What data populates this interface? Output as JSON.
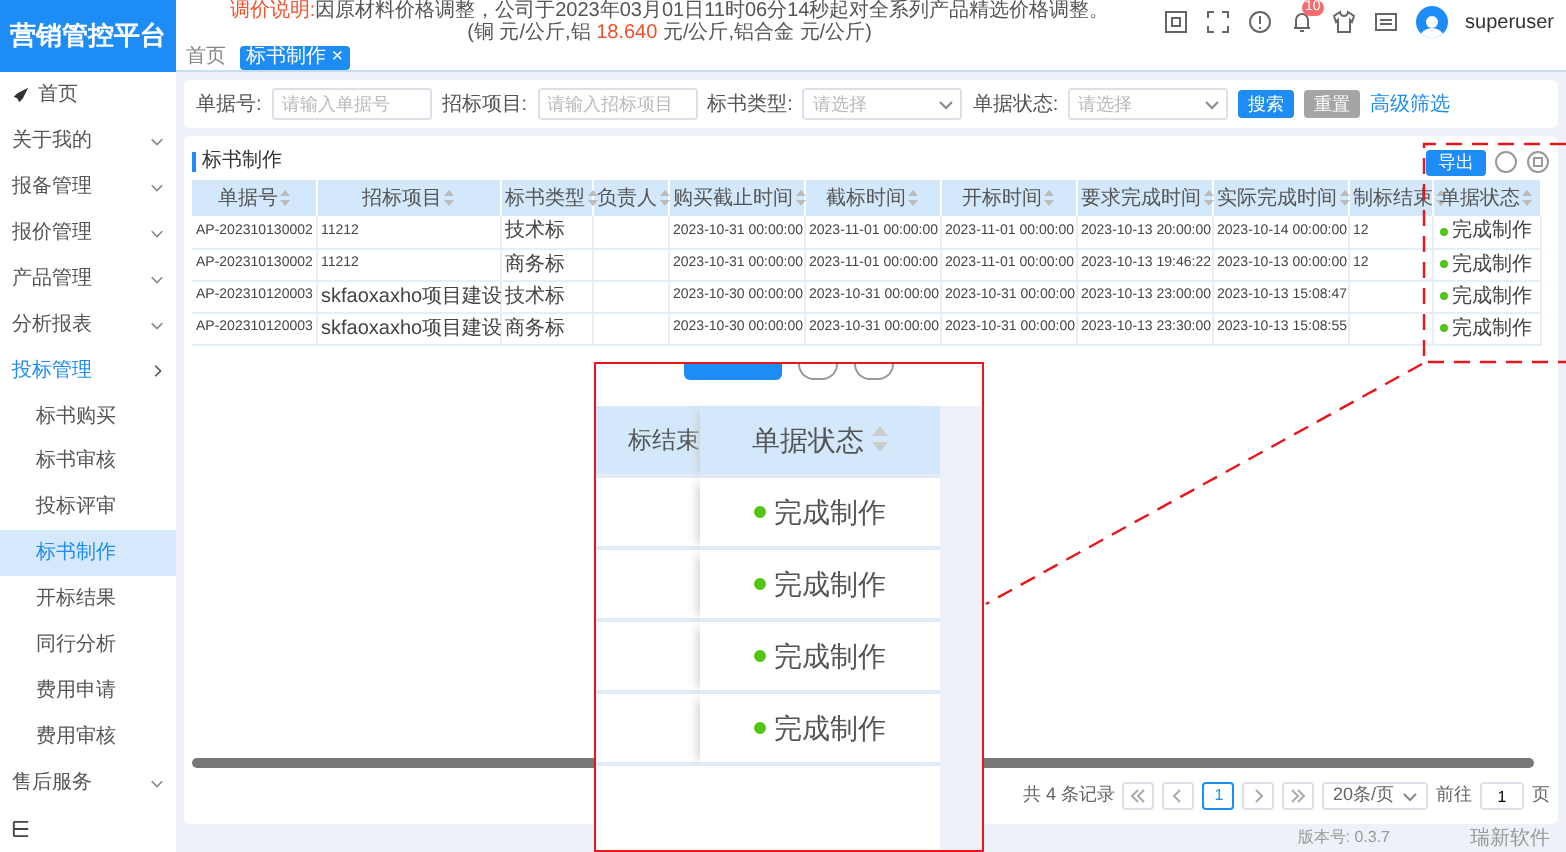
{
  "app": {
    "logo": "营销管控平台"
  },
  "notice": {
    "label": "调价说明:",
    "line_1": "因原材料价格调整，公司于2023年03月01日11时06分14秒起对全系列产品精选价格调整。",
    "line_2": [
      {
        "text": "(铜 元/公斤,铝 ",
        "highlight": false
      },
      {
        "text": "18.640",
        "highlight": true
      },
      {
        "text": " 元/公斤,铝合金 元/公斤)",
        "highlight": false
      }
    ]
  },
  "header": {
    "notification_count": "10",
    "username": "superuser"
  },
  "tabs": [
    {
      "label": "首页",
      "selected": false,
      "closable": false
    },
    {
      "label": "标书制作",
      "selected": true,
      "closable": true,
      "close": "×"
    }
  ],
  "sidebar": {
    "items": [
      {
        "label": "首页",
        "kind": "link"
      },
      {
        "label": "关于我的",
        "kind": "group",
        "expanded": false
      },
      {
        "label": "报备管理",
        "kind": "group",
        "expanded": false
      },
      {
        "label": "报价管理",
        "kind": "group",
        "expanded": false
      },
      {
        "label": "产品管理",
        "kind": "group",
        "expanded": false
      },
      {
        "label": "分析报表",
        "kind": "group",
        "expanded": false
      },
      {
        "label": "投标管理",
        "kind": "group",
        "expanded": true,
        "children": [
          {
            "label": "标书购买",
            "selected": false
          },
          {
            "label": "标书审核",
            "selected": false
          },
          {
            "label": "投标评审",
            "selected": false
          },
          {
            "label": "标书制作",
            "selected": true
          },
          {
            "label": "开标结果",
            "selected": false
          },
          {
            "label": "同行分析",
            "selected": false
          },
          {
            "label": "费用申请",
            "selected": false
          },
          {
            "label": "费用审核",
            "selected": false
          }
        ]
      },
      {
        "label": "售后服务",
        "kind": "group",
        "expanded": false
      }
    ]
  },
  "filters": [
    {
      "label": "单据号:",
      "kind": "input",
      "placeholder": "请输入单据号"
    },
    {
      "label": "招标项目:",
      "kind": "input",
      "placeholder": "请输入招标项目"
    },
    {
      "label": "标书类型:",
      "kind": "select",
      "placeholder": "请选择"
    },
    {
      "label": "单据状态:",
      "kind": "select",
      "placeholder": "请选择"
    }
  ],
  "filter_buttons": {
    "search": "搜索",
    "reset": "重置",
    "advanced": "高级筛选"
  },
  "panel": {
    "title": "标书制作",
    "export": "导出"
  },
  "table": {
    "columns": [
      "单据号",
      "招标项目",
      "标书类型",
      "负责人",
      "购买截止时间",
      "截标时间",
      "开标时间",
      "要求完成时间",
      "实际完成时间",
      "制标结束",
      "单据状态"
    ],
    "rows": [
      {
        "cells": [
          "AP-202310130002",
          "11212",
          "技术标",
          "",
          "2023-10-31 00:00:00",
          "2023-11-01 00:00:00",
          "2023-11-01 00:00:00",
          "2023-10-13 20:00:00",
          "2023-10-14 00:00:00",
          "12"
        ],
        "status": "完成制作"
      },
      {
        "cells": [
          "AP-202310130002",
          "11212",
          "商务标",
          "",
          "2023-10-31 00:00:00",
          "2023-11-01 00:00:00",
          "2023-11-01 00:00:00",
          "2023-10-13 19:46:22",
          "2023-10-13 00:00:00",
          "12"
        ],
        "status": "完成制作"
      },
      {
        "cells": [
          "AP-202310120003",
          "skfaoxaxho项目建设",
          "技术标",
          "",
          "2023-10-30 00:00:00",
          "2023-10-31 00:00:00",
          "2023-10-31 00:00:00",
          "2023-10-13 23:00:00",
          "2023-10-13 15:08:47",
          ""
        ],
        "status": "完成制作"
      },
      {
        "cells": [
          "AP-202310120003",
          "skfaoxaxho项目建设",
          "商务标",
          "",
          "2023-10-30 00:00:00",
          "2023-10-31 00:00:00",
          "2023-10-31 00:00:00",
          "2023-10-13 23:30:00",
          "2023-10-13 15:08:55",
          ""
        ],
        "status": "完成制作"
      }
    ]
  },
  "pagination": {
    "total": "共 4 条记录",
    "pages": [
      {
        "label": "1",
        "selected": true
      }
    ],
    "page_size": "20条/页",
    "goto_label": "前往",
    "goto_value": "1",
    "goto_unit": "页"
  },
  "footer": {
    "version": "版本号: 0.3.7",
    "company": "瑞新软件"
  },
  "magnifier": {
    "cut_header": "标结束",
    "header": "单据状态",
    "statuses": [
      "完成制作",
      "完成制作",
      "完成制作",
      "完成制作"
    ]
  }
}
